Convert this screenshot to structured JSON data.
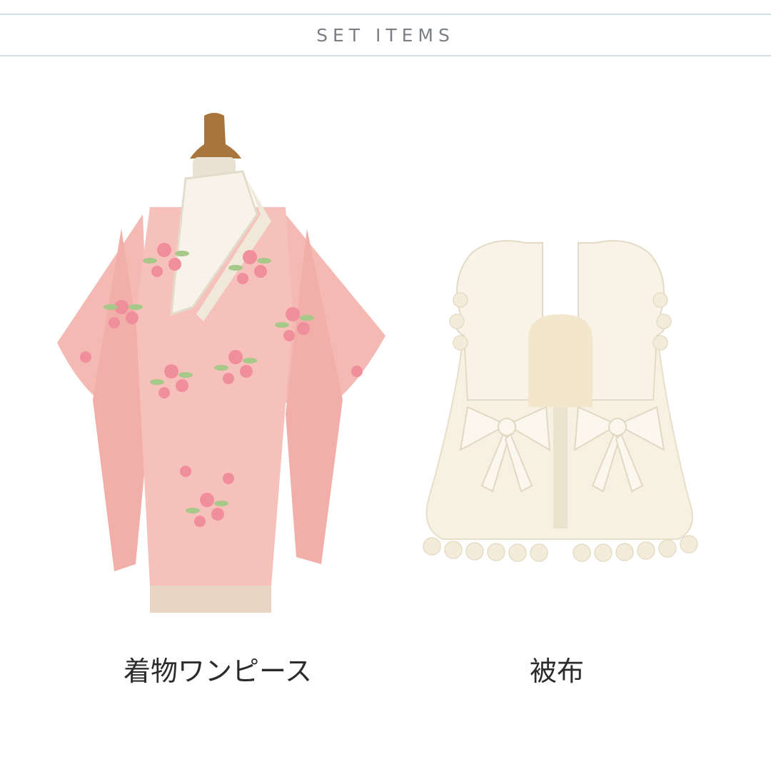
{
  "section": {
    "title": "SET ITEMS"
  },
  "items": [
    {
      "name": "着物ワンピース",
      "image": "pink-kimono-dress-on-mannequin"
    },
    {
      "name": "被布",
      "image": "cream-quilted-hifu-vest"
    }
  ],
  "colors": {
    "rule": "#d6dee3",
    "title": "#7b7f83",
    "kimono": "#f4b9b3",
    "hifu": "#f6f0e2",
    "caption": "#2b2b2b"
  }
}
